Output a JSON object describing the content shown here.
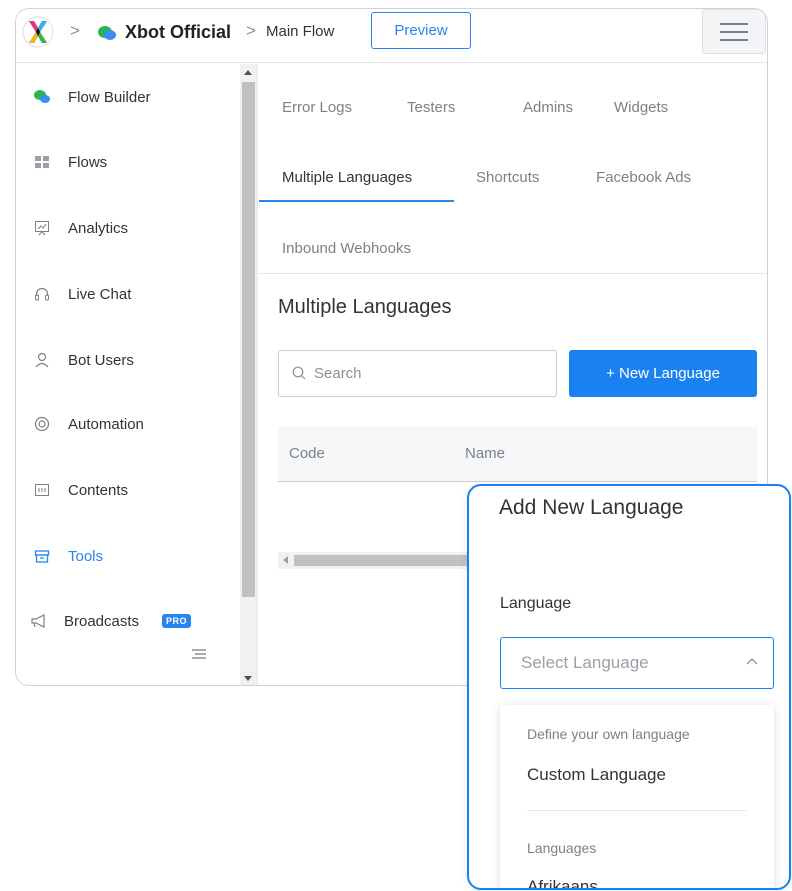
{
  "header": {
    "separator": ">",
    "bot_name": "Xbot Official",
    "flow_name": "Main Flow",
    "preview_label": "Preview"
  },
  "sidebar": {
    "items": [
      {
        "label": "Flow Builder",
        "icon": "flow-builder-icon"
      },
      {
        "label": "Flows",
        "icon": "grid-icon"
      },
      {
        "label": "Analytics",
        "icon": "analytics-icon"
      },
      {
        "label": "Live Chat",
        "icon": "headset-icon"
      },
      {
        "label": "Bot Users",
        "icon": "user-icon"
      },
      {
        "label": "Automation",
        "icon": "automation-icon"
      },
      {
        "label": "Contents",
        "icon": "contents-icon"
      },
      {
        "label": "Tools",
        "icon": "toolbox-icon",
        "active": true
      },
      {
        "label": "Broadcasts",
        "icon": "megaphone-icon",
        "badge": "PRO"
      }
    ]
  },
  "tabs": {
    "error_logs": "Error Logs",
    "testers": "Testers",
    "admins": "Admins",
    "widgets": "Widgets",
    "multiple_languages": "Multiple Languages",
    "shortcuts": "Shortcuts",
    "facebook_ads": "Facebook Ads",
    "inbound_webhooks": "Inbound Webhooks"
  },
  "main": {
    "title": "Multiple Languages",
    "search_placeholder": "Search",
    "new_language_label": "+  New Language",
    "table": {
      "columns": [
        "Code",
        "Name"
      ]
    }
  },
  "popup": {
    "title": "Add New Language",
    "field_label": "Language",
    "select_placeholder": "Select Language",
    "dropdown": {
      "group1": "Define your own language",
      "custom_language": "Custom Language",
      "group2": "Languages",
      "first_language": "Afrikaans"
    }
  },
  "colors": {
    "accent": "#1a82f0",
    "text": "#333333",
    "muted": "#7b8188"
  }
}
